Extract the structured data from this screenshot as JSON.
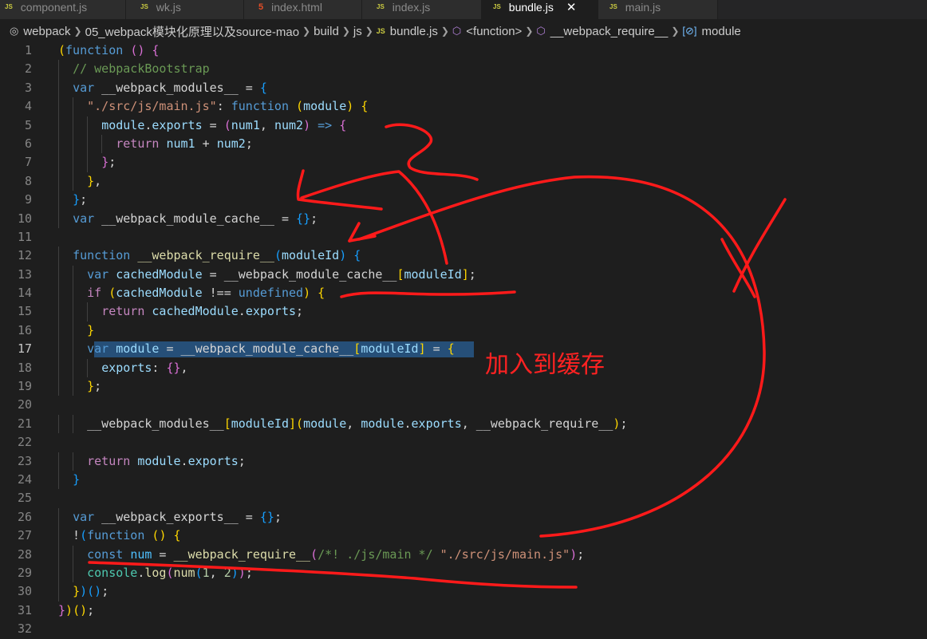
{
  "tabs": [
    {
      "label": "component.js",
      "type": "js",
      "active": false
    },
    {
      "label": "wk.js",
      "type": "js",
      "active": false
    },
    {
      "label": "index.html",
      "type": "html",
      "active": false
    },
    {
      "label": "index.js",
      "type": "js",
      "active": false
    },
    {
      "label": "bundle.js",
      "type": "js",
      "active": true
    },
    {
      "label": "main.js",
      "type": "js",
      "active": false
    }
  ],
  "breadcrumb": [
    "webpack",
    "05_webpack模块化原理以及source-mao",
    "build",
    "js",
    "bundle.js",
    "<function>",
    "__webpack_require__",
    "module"
  ],
  "annotation": {
    "text": "加入到缓存",
    "color": "#ff2222"
  },
  "editor": {
    "current_line": 17,
    "lines": [
      {
        "n": "1",
        "text": "(function () {"
      },
      {
        "n": "2",
        "text": "  // webpackBootstrap"
      },
      {
        "n": "3",
        "text": "  var __webpack_modules__ = {"
      },
      {
        "n": "4",
        "text": "    \"./src/js/main.js\": function (module) {"
      },
      {
        "n": "5",
        "text": "      module.exports = (num1, num2) => {"
      },
      {
        "n": "6",
        "text": "        return num1 + num2;"
      },
      {
        "n": "7",
        "text": "      };"
      },
      {
        "n": "8",
        "text": "    },"
      },
      {
        "n": "9",
        "text": "  };"
      },
      {
        "n": "10",
        "text": "  var __webpack_module_cache__ = {};"
      },
      {
        "n": "11",
        "text": ""
      },
      {
        "n": "12",
        "text": "  function __webpack_require__(moduleId) {"
      },
      {
        "n": "13",
        "text": "    var cachedModule = __webpack_module_cache__[moduleId];"
      },
      {
        "n": "14",
        "text": "    if (cachedModule !== undefined) {"
      },
      {
        "n": "15",
        "text": "      return cachedModule.exports;"
      },
      {
        "n": "16",
        "text": "    }"
      },
      {
        "n": "17",
        "text": "    var module = __webpack_module_cache__[moduleId] = {"
      },
      {
        "n": "18",
        "text": "      exports: {},"
      },
      {
        "n": "19",
        "text": "    };"
      },
      {
        "n": "20",
        "text": ""
      },
      {
        "n": "21",
        "text": "    __webpack_modules__[moduleId](module, module.exports, __webpack_require__);"
      },
      {
        "n": "22",
        "text": ""
      },
      {
        "n": "23",
        "text": "    return module.exports;"
      },
      {
        "n": "24",
        "text": "  }"
      },
      {
        "n": "25",
        "text": ""
      },
      {
        "n": "26",
        "text": "  var __webpack_exports__ = {};"
      },
      {
        "n": "27",
        "text": "  !(function () {"
      },
      {
        "n": "28",
        "text": "    const num = __webpack_require__(/*! ./js/main */ \"./src/js/main.js\");"
      },
      {
        "n": "29",
        "text": "    console.log(num(1, 2));"
      },
      {
        "n": "30",
        "text": "  })();"
      },
      {
        "n": "31",
        "text": "})();"
      },
      {
        "n": "32",
        "text": ""
      }
    ]
  }
}
